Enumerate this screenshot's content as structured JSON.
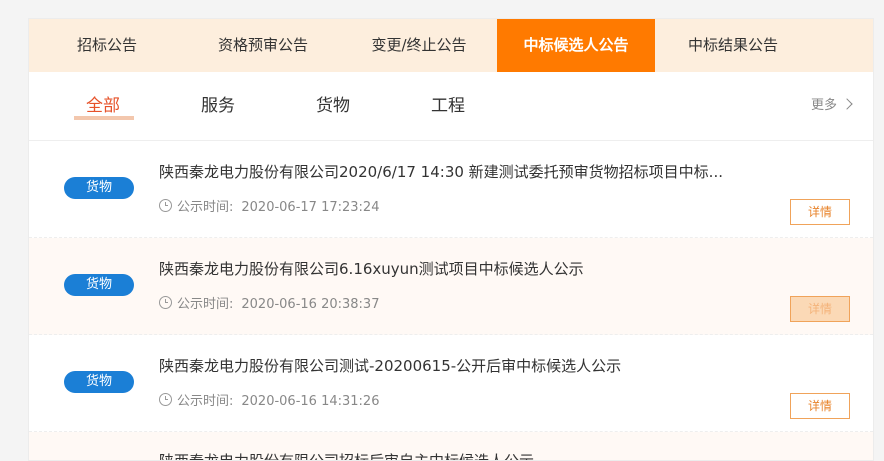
{
  "tabs": [
    {
      "label": "招标公告"
    },
    {
      "label": "资格预审公告"
    },
    {
      "label": "变更/终止公告"
    },
    {
      "label": "中标候选人公告"
    },
    {
      "label": "中标结果公告"
    }
  ],
  "active_tab": "中标候选人公告",
  "categories": [
    {
      "label": "全部"
    },
    {
      "label": "服务"
    },
    {
      "label": "货物"
    },
    {
      "label": "工程"
    }
  ],
  "active_category": "全部",
  "more_label": "更多",
  "meta_label": "公示时间:",
  "detail_label": "详情",
  "items": [
    {
      "badge": "货物",
      "title": "陕西秦龙电力股份有限公司2020/6/17 14:30 新建测试委托预审货物招标项目中标...",
      "time": "2020-06-17 17:23:24"
    },
    {
      "badge": "货物",
      "title": "陕西秦龙电力股份有限公司6.16xuyun测试项目中标候选人公示",
      "time": "2020-06-16 20:38:37"
    },
    {
      "badge": "货物",
      "title": "陕西秦龙电力股份有限公司测试-20200615-公开后审中标候选人公示",
      "time": "2020-06-16 14:31:26"
    },
    {
      "title": "陕西秦龙电力股份有限公司招标后审自主中标候选人公示"
    }
  ],
  "colors": {
    "accent": "#ff7a00",
    "tab_bar_bg": "#fdeedd",
    "badge_bg": "#1b7fd6",
    "active_category": "#e6522a",
    "detail_border": "#f0a35a"
  }
}
